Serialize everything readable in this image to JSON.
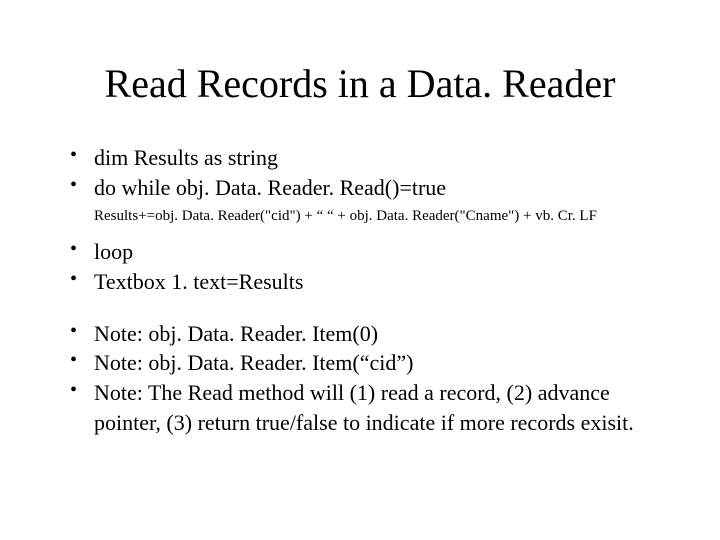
{
  "title": "Read Records in a Data. Reader",
  "bullets_top": [
    "dim Results as string",
    "do while obj. Data. Reader. Read()=true"
  ],
  "code_line": "Results+=obj. Data. Reader(\"cid\") + “ “  + obj. Data. Reader(\"Cname\") + vb. Cr. LF",
  "bullets_mid": [
    "loop",
    "Textbox 1. text=Results"
  ],
  "bullets_notes": [
    "Note: obj. Data. Reader. Item(0)",
    "Note: obj. Data. Reader. Item(“cid”)",
    "Note: The Read method will (1) read a record, (2) advance pointer, (3) return true/false to indicate if more records exisit."
  ]
}
